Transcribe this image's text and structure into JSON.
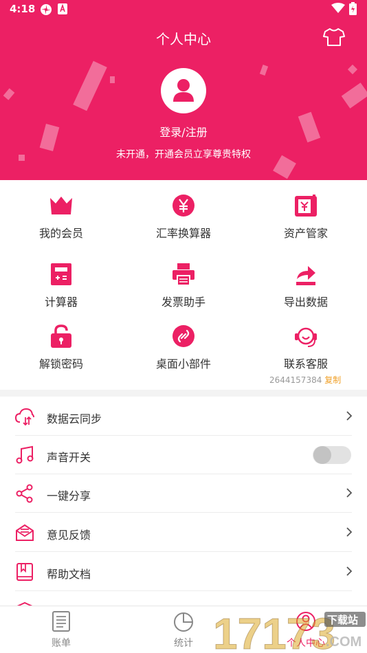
{
  "status_bar": {
    "time": "4:18"
  },
  "header": {
    "title": "个人中心",
    "login_label": "登录/注册",
    "subtitle": "未开通，开通会员立享尊贵特权"
  },
  "grid": [
    {
      "label": "我的会员",
      "icon": "crown-icon"
    },
    {
      "label": "汇率换算器",
      "icon": "yen-icon"
    },
    {
      "label": "资产管家",
      "icon": "wallet-icon"
    },
    {
      "label": "计算器",
      "icon": "calculator-icon"
    },
    {
      "label": "发票助手",
      "icon": "printer-icon"
    },
    {
      "label": "导出数据",
      "icon": "export-icon"
    },
    {
      "label": "解锁密码",
      "icon": "lock-icon"
    },
    {
      "label": "桌面小部件",
      "icon": "link-icon"
    },
    {
      "label": "联系客服",
      "icon": "headset-icon"
    }
  ],
  "contact": {
    "phone": "2644157384",
    "copy": "复制"
  },
  "settings": [
    {
      "label": "数据云同步",
      "icon": "cloud-sync-icon"
    },
    {
      "label": "声音开关",
      "icon": "music-icon",
      "toggle_on": false
    },
    {
      "label": "一键分享",
      "icon": "share-icon"
    },
    {
      "label": "意见反馈",
      "icon": "mail-icon"
    },
    {
      "label": "帮助文档",
      "icon": "book-icon"
    }
  ],
  "tabs": [
    {
      "label": "账单",
      "icon": "bill-icon"
    },
    {
      "label": "统计",
      "icon": "pie-chart-icon"
    },
    {
      "label": "个人中心",
      "icon": "person-icon",
      "active": true
    }
  ],
  "watermark": {
    "number": "17173",
    "text": "下载站",
    "domain": ".COM"
  },
  "colors": {
    "accent": "#ec2064",
    "secondary": "#f0a028"
  }
}
